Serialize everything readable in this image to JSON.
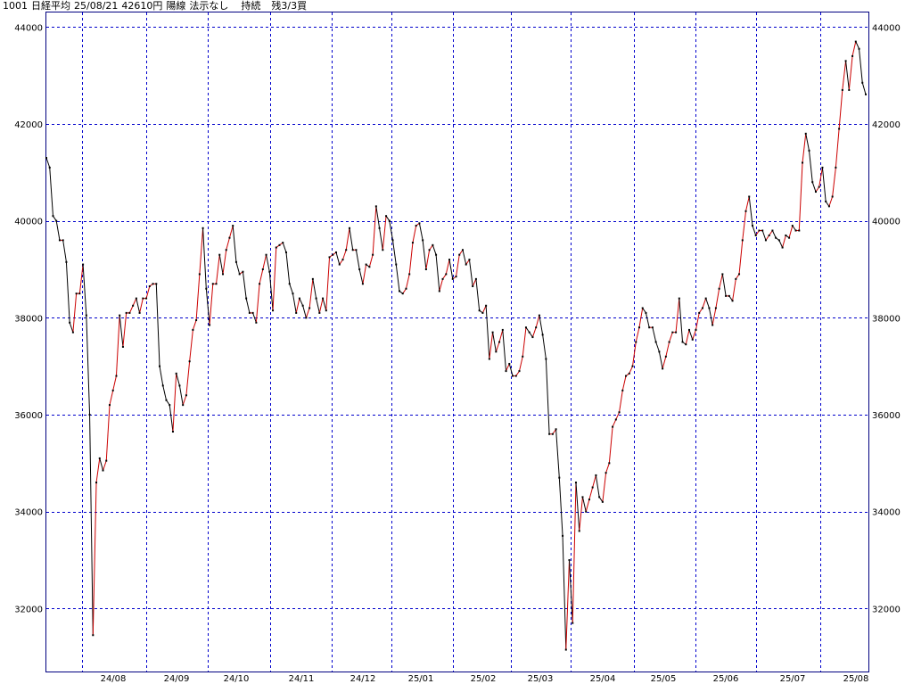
{
  "header": {
    "code": "1001",
    "name": "日経平均",
    "date": "25/08/21",
    "price": "42610円",
    "candle": "陽線",
    "signal": "法示なし",
    "position": "持続",
    "remaining": "残3/3買"
  },
  "colors": {
    "frame": "#000080",
    "grid": "#0000cc",
    "up_line": "#cc0000",
    "down_line": "#000000",
    "marker": "#000000"
  },
  "chart_data": {
    "type": "line",
    "title": "",
    "xlabel": "",
    "ylabel": "",
    "ylim": [
      30700,
      44300
    ],
    "y_ticks": [
      32000,
      34000,
      36000,
      38000,
      40000,
      42000,
      44000
    ],
    "x_ticks": [
      "24/08",
      "24/09",
      "24/10",
      "24/11",
      "24/12",
      "25/01",
      "25/02",
      "25/03",
      "25/04",
      "25/05",
      "25/06",
      "25/07",
      "25/08"
    ],
    "grid": true,
    "legend": "none",
    "series": [
      {
        "color_up": "#cc0000",
        "color_down": "#000000",
        "values": [
          41300,
          41100,
          40100,
          40000,
          39600,
          39600,
          39150,
          37900,
          37700,
          38500,
          38500,
          39100,
          38050,
          36000,
          31450,
          34600,
          35100,
          34850,
          35050,
          36200,
          36500,
          36800,
          38050,
          37400,
          38100,
          38100,
          38250,
          38400,
          38100,
          38400,
          38400,
          38650,
          38700,
          38700,
          37000,
          36600,
          36300,
          36200,
          35650,
          36850,
          36600,
          36200,
          36400,
          37100,
          37750,
          37950,
          38900,
          39850,
          38600,
          37850,
          38700,
          38700,
          39300,
          38900,
          39400,
          39650,
          39900,
          39150,
          38900,
          38950,
          38400,
          38100,
          38100,
          37900,
          38700,
          39000,
          39300,
          38950,
          38150,
          39450,
          39500,
          39550,
          39350,
          38700,
          38500,
          38100,
          38400,
          38250,
          38000,
          38200,
          38800,
          38400,
          38100,
          38400,
          38150,
          39250,
          39300,
          39350,
          39100,
          39200,
          39400,
          39850,
          39400,
          39400,
          39000,
          38700,
          39100,
          39050,
          39300,
          40300,
          39850,
          39400,
          40100,
          40000,
          39600,
          39100,
          38550,
          38500,
          38600,
          38900,
          39550,
          39900,
          39950,
          39600,
          39000,
          39400,
          39500,
          39300,
          38550,
          38800,
          38900,
          39200,
          38800,
          38850,
          39300,
          39400,
          39100,
          39200,
          38650,
          38800,
          38150,
          38100,
          38250,
          37150,
          37700,
          37300,
          37500,
          37750,
          36900,
          37050,
          36800,
          36800,
          36900,
          37200,
          37800,
          37700,
          37600,
          37800,
          38050,
          37650,
          37150,
          35600,
          35600,
          35700,
          34700,
          33500,
          31150,
          33000,
          31700,
          34600,
          33600,
          34300,
          34000,
          34250,
          34500,
          34750,
          34300,
          34200,
          34800,
          35000,
          35750,
          35900,
          36050,
          36500,
          36800,
          36850,
          37000,
          37500,
          37800,
          38200,
          38100,
          37800,
          37800,
          37500,
          37300,
          36950,
          37200,
          37500,
          37700,
          37700,
          38400,
          37500,
          37450,
          37750,
          37550,
          37750,
          38100,
          38200,
          38400,
          38200,
          37850,
          38200,
          38600,
          38900,
          38450,
          38450,
          38350,
          38800,
          38900,
          39600,
          40200,
          40500,
          39900,
          39700,
          39800,
          39800,
          39600,
          39700,
          39800,
          39650,
          39600,
          39450,
          39700,
          39650,
          39900,
          39800,
          39800,
          41200,
          41800,
          41450,
          40800,
          40600,
          40700,
          41100,
          40400,
          40300,
          40500,
          41100,
          41900,
          42700,
          43300,
          42700,
          43400,
          43700,
          43550,
          42850,
          42610
        ]
      }
    ]
  }
}
